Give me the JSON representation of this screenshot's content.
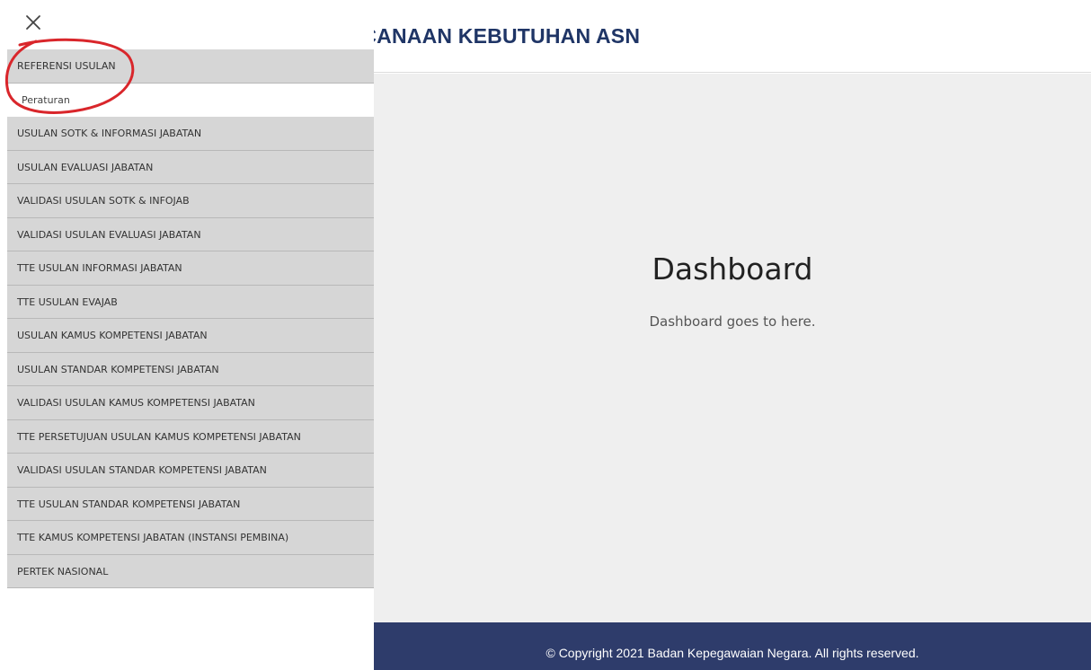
{
  "header": {
    "title": "ENCANAAN KEBUTUHAN ASN"
  },
  "sidebar": {
    "items": [
      {
        "label": "REFERENSI USULAN"
      },
      {
        "label": "Peraturan"
      },
      {
        "label": "USULAN SOTK & INFORMASI JABATAN"
      },
      {
        "label": "USULAN EVALUASI JABATAN"
      },
      {
        "label": "VALIDASI USULAN SOTK & INFOJAB"
      },
      {
        "label": "VALIDASI USULAN EVALUASI JABATAN"
      },
      {
        "label": "TTE USULAN INFORMASI JABATAN"
      },
      {
        "label": "TTE USULAN EVAJAB"
      },
      {
        "label": "USULAN KAMUS KOMPETENSI JABATAN"
      },
      {
        "label": "USULAN STANDAR KOMPETENSI JABATAN"
      },
      {
        "label": "VALIDASI USULAN KAMUS KOMPETENSI JABATAN"
      },
      {
        "label": "TTE PERSETUJUAN USULAN KAMUS KOMPETENSI JABATAN"
      },
      {
        "label": "VALIDASI USULAN STANDAR KOMPETENSI JABATAN"
      },
      {
        "label": "TTE USULAN STANDAR KOMPETENSI JABATAN"
      },
      {
        "label": "TTE KAMUS KOMPETENSI JABATAN (INSTANSI PEMBINA)"
      },
      {
        "label": "PERTEK NASIONAL"
      }
    ]
  },
  "main": {
    "title": "Dashboard",
    "subtitle": "Dashboard goes to here."
  },
  "footer": {
    "copyright": "© Copyright 2021 Badan Kepegawaian Negara. All rights reserved."
  },
  "colors": {
    "header_text": "#1f3566",
    "footer_bg": "#2e3c6b",
    "menu_bg": "#d6d6d6",
    "annotation": "#d9262b"
  },
  "icons": {
    "close": "close-icon"
  }
}
